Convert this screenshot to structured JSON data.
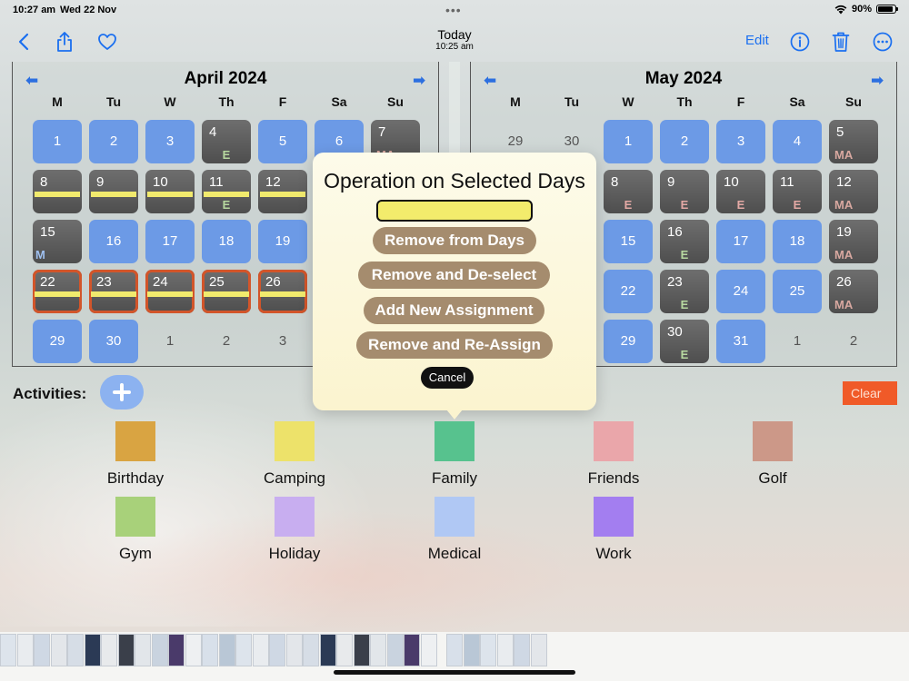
{
  "status": {
    "time": "10:27 am",
    "date": "Wed 22 Nov",
    "dots": "•••",
    "battery": "90%",
    "battery_level": 0.9
  },
  "nav": {
    "title": "Today",
    "subtitle": "10:25 am",
    "edit_label": "Edit"
  },
  "calendars": [
    {
      "title": "April 2024",
      "weekdays": [
        "M",
        "Tu",
        "W",
        "Th",
        "F",
        "Sa",
        "Su"
      ],
      "weeks": [
        [
          {
            "n": "1",
            "s": "blue"
          },
          {
            "n": "2",
            "s": "blue"
          },
          {
            "n": "3",
            "s": "blue"
          },
          {
            "n": "4",
            "s": "gray",
            "m": "E"
          },
          {
            "n": "5",
            "s": "blue"
          },
          {
            "n": "6",
            "s": "blue"
          },
          {
            "n": "7",
            "s": "gray",
            "m": "MA"
          }
        ],
        [
          {
            "n": "8",
            "s": "gray",
            "y": true
          },
          {
            "n": "9",
            "s": "gray",
            "y": true
          },
          {
            "n": "10",
            "s": "gray",
            "y": true
          },
          {
            "n": "11",
            "s": "gray",
            "y": true,
            "m": "E"
          },
          {
            "n": "12",
            "s": "gray",
            "y": true
          },
          {
            "n": "",
            "s": "hidden"
          },
          {
            "n": "",
            "s": "hidden"
          }
        ],
        [
          {
            "n": "15",
            "s": "gray",
            "m": "M"
          },
          {
            "n": "16",
            "s": "blue"
          },
          {
            "n": "17",
            "s": "blue"
          },
          {
            "n": "18",
            "s": "blue"
          },
          {
            "n": "19",
            "s": "blue"
          },
          {
            "n": "",
            "s": "hidden"
          },
          {
            "n": "",
            "s": "hidden"
          }
        ],
        [
          {
            "n": "22",
            "s": "gray",
            "y": true,
            "sel": true
          },
          {
            "n": "23",
            "s": "gray",
            "y": true,
            "sel": true
          },
          {
            "n": "24",
            "s": "gray",
            "y": true,
            "sel": true
          },
          {
            "n": "25",
            "s": "gray",
            "y": true,
            "sel": true
          },
          {
            "n": "26",
            "s": "gray",
            "y": true,
            "sel": true
          },
          {
            "n": "",
            "s": "hidden"
          },
          {
            "n": "",
            "s": "hidden"
          }
        ],
        [
          {
            "n": "29",
            "s": "blue"
          },
          {
            "n": "30",
            "s": "blue"
          },
          {
            "n": "1",
            "s": "none"
          },
          {
            "n": "2",
            "s": "none"
          },
          {
            "n": "3",
            "s": "none"
          },
          {
            "n": "",
            "s": "hidden"
          },
          {
            "n": "",
            "s": "hidden"
          }
        ]
      ]
    },
    {
      "title": "May 2024",
      "weekdays": [
        "M",
        "Tu",
        "W",
        "Th",
        "F",
        "Sa",
        "Su"
      ],
      "weeks": [
        [
          {
            "n": "29",
            "s": "none"
          },
          {
            "n": "30",
            "s": "none"
          },
          {
            "n": "1",
            "s": "blue"
          },
          {
            "n": "2",
            "s": "blue"
          },
          {
            "n": "3",
            "s": "blue"
          },
          {
            "n": "4",
            "s": "blue"
          },
          {
            "n": "5",
            "s": "gray",
            "m": "MA"
          }
        ],
        [
          {
            "n": "",
            "s": "hidden"
          },
          {
            "n": "",
            "s": "hidden"
          },
          {
            "n": "8",
            "s": "gray",
            "m": "E",
            "mc": "pink"
          },
          {
            "n": "9",
            "s": "gray",
            "m": "E",
            "mc": "pink"
          },
          {
            "n": "10",
            "s": "gray",
            "m": "E",
            "mc": "pink"
          },
          {
            "n": "11",
            "s": "gray",
            "m": "E",
            "mc": "pink"
          },
          {
            "n": "12",
            "s": "gray",
            "m": "MA"
          }
        ],
        [
          {
            "n": "",
            "s": "hidden"
          },
          {
            "n": "",
            "s": "hidden"
          },
          {
            "n": "15",
            "s": "blue"
          },
          {
            "n": "16",
            "s": "gray",
            "m": "E"
          },
          {
            "n": "17",
            "s": "blue"
          },
          {
            "n": "18",
            "s": "blue"
          },
          {
            "n": "19",
            "s": "gray",
            "m": "MA"
          }
        ],
        [
          {
            "n": "",
            "s": "hidden"
          },
          {
            "n": "",
            "s": "hidden"
          },
          {
            "n": "22",
            "s": "blue"
          },
          {
            "n": "23",
            "s": "gray",
            "m": "E"
          },
          {
            "n": "24",
            "s": "blue"
          },
          {
            "n": "25",
            "s": "blue"
          },
          {
            "n": "26",
            "s": "gray",
            "m": "MA"
          }
        ],
        [
          {
            "n": "",
            "s": "hidden"
          },
          {
            "n": "",
            "s": "hidden"
          },
          {
            "n": "29",
            "s": "blue"
          },
          {
            "n": "30",
            "s": "gray",
            "m": "E"
          },
          {
            "n": "31",
            "s": "blue"
          },
          {
            "n": "1",
            "s": "none"
          },
          {
            "n": "2",
            "s": "none"
          }
        ]
      ]
    }
  ],
  "popover": {
    "title": "Operation on Selected Days",
    "name_value": "",
    "buttons": [
      "Remove from Days",
      "Remove and De-select",
      "Add New Assignment",
      "Remove and Re-Assign"
    ],
    "cancel": "Cancel"
  },
  "activities": {
    "label": "Activities:",
    "clear_label": "Clear",
    "items": [
      {
        "name": "Birthday",
        "color": "#d9a442"
      },
      {
        "name": "Camping",
        "color": "#ede26a"
      },
      {
        "name": "Family",
        "color": "#57c28e"
      },
      {
        "name": "Friends",
        "color": "#eaa6aa"
      },
      {
        "name": "Golf",
        "color": "#cc9888"
      },
      {
        "name": "Gym",
        "color": "#a8d17a"
      },
      {
        "name": "Holiday",
        "color": "#c8aef0"
      },
      {
        "name": "Medical",
        "color": "#b0c8f4"
      },
      {
        "name": "Work",
        "color": "#a37ef0"
      }
    ]
  },
  "colors": {
    "accent": "#1a6ff0",
    "blue_day": "#6c9ae6",
    "gray_day": "#5e5e5e",
    "selection": "#d2552a",
    "assignment_bar": "#f1ea6d",
    "clear": "#f05a28",
    "action_button": "#a58c6e"
  }
}
